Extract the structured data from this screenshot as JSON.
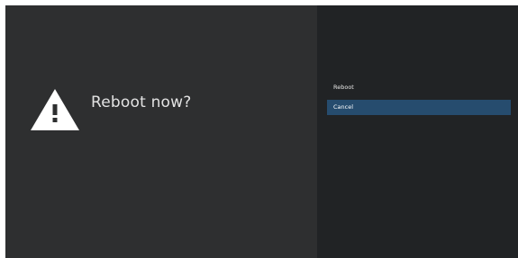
{
  "dialog": {
    "title": "Reboot now?",
    "icon": "warning-icon"
  },
  "actions": {
    "items": [
      {
        "label": "Reboot",
        "selected": false
      },
      {
        "label": "Cancel",
        "selected": true
      }
    ]
  },
  "colors": {
    "main_background": "#2e2f30",
    "side_background": "#212325",
    "selected_background": "#264c6e",
    "text": "#e3e3e3"
  }
}
